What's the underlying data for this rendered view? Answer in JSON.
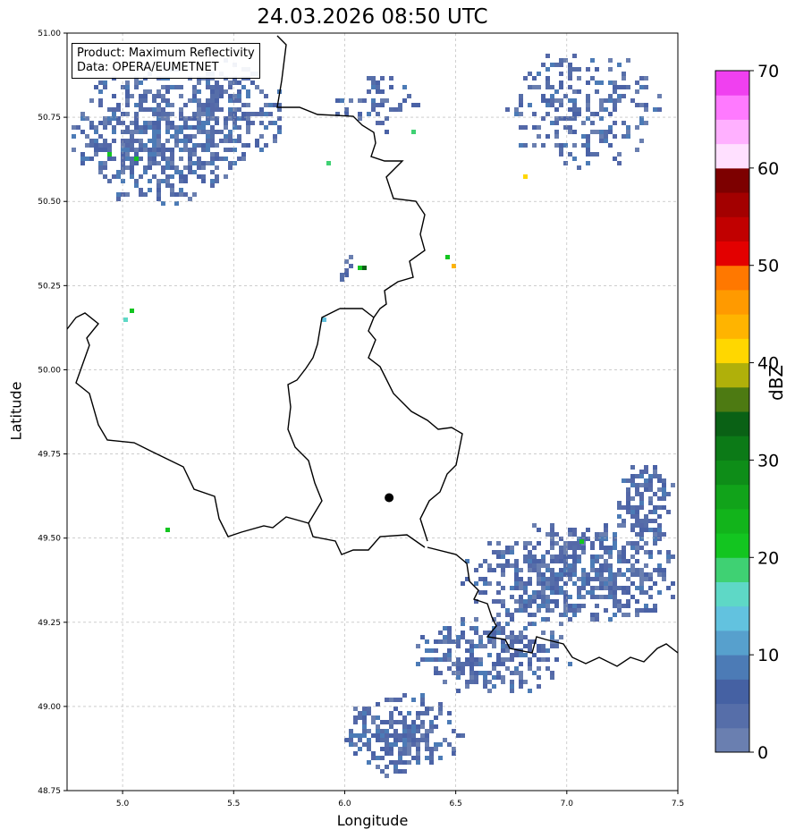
{
  "map": {
    "title": "24.03.2026 08:50 UTC",
    "xlabel": "Longitude",
    "ylabel": "Latitude",
    "info_line1": "Product: Maximum Reflectivity",
    "info_line2": "Data: OPERA/EUMETNET",
    "marker": {
      "lon": 6.2,
      "lat": 49.62
    },
    "extent": {
      "lon": [
        4.75,
        7.5
      ],
      "lat": [
        48.75,
        51.0
      ]
    }
  },
  "chart_data": {
    "type": "heatmap",
    "xticks": [
      "5.0",
      "5.5",
      "6.0",
      "6.5",
      "7.0",
      "7.5"
    ],
    "yticks": [
      "51.00",
      "50.75",
      "50.50",
      "50.25",
      "50.00",
      "49.75",
      "49.50",
      "49.25",
      "49.00",
      "48.75"
    ],
    "grid": true,
    "colorbar": {
      "label": "dBZ",
      "ticks": [
        "70",
        "60",
        "50",
        "40",
        "30",
        "20",
        "10",
        "0"
      ],
      "range": [
        0,
        70
      ],
      "colors": [
        "#6a7fb0",
        "#566ea9",
        "#4561a3",
        "#4c7bb6",
        "#57a0cd",
        "#62c2df",
        "#5ed8c6",
        "#3fd173",
        "#13c520",
        "#12b41b",
        "#11a31a",
        "#0e8d18",
        "#0c7a17",
        "#0a6115",
        "#4d7a12",
        "#b0b00a",
        "#ffd700",
        "#ffb400",
        "#ff9a00",
        "#ff7800",
        "#e30000",
        "#c10000",
        "#a30000",
        "#7d0000",
        "#ffe0ff",
        "#ffb0ff",
        "#ff7aff",
        "#f040f0"
      ]
    }
  }
}
